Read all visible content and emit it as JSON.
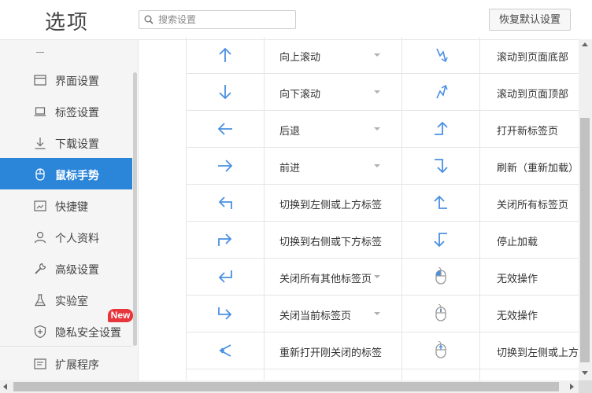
{
  "header": {
    "title": "选项",
    "search_placeholder": "搜索设置",
    "reset_button": "恢复默认设置"
  },
  "sidebar": {
    "items": [
      {
        "label": "界面设置",
        "icon": "window-icon"
      },
      {
        "label": "标签设置",
        "icon": "laptop-icon"
      },
      {
        "label": "下载设置",
        "icon": "download-icon"
      },
      {
        "label": "鼠标手势",
        "icon": "mouse-icon",
        "active": true
      },
      {
        "label": "快捷键",
        "icon": "keyboard-icon"
      },
      {
        "label": "个人资料",
        "icon": "person-icon"
      },
      {
        "label": "高级设置",
        "icon": "wrench-icon"
      },
      {
        "label": "实验室",
        "icon": "flask-icon"
      },
      {
        "label": "隐私安全设置",
        "icon": "shield-icon",
        "badge": "New"
      },
      {
        "label": "扩展程序",
        "icon": "extension-icon"
      }
    ],
    "accent_color": "#2b86d9",
    "badge_color": "#e8343b"
  },
  "gestures": {
    "left_column": [
      {
        "icon": "arrow-up-icon",
        "action": "向上滚动",
        "has_dropdown": true
      },
      {
        "icon": "arrow-down-icon",
        "action": "向下滚动",
        "has_dropdown": true
      },
      {
        "icon": "arrow-left-icon",
        "action": "后退",
        "has_dropdown": true
      },
      {
        "icon": "arrow-right-icon",
        "action": "前进",
        "has_dropdown": true
      },
      {
        "icon": "arrow-up-left-icon",
        "action": "切换到左侧或上方标签",
        "has_dropdown": true
      },
      {
        "icon": "arrow-up-right-icon",
        "action": "切换到右侧或下方标签",
        "has_dropdown": true
      },
      {
        "icon": "arrow-down-left-icon",
        "action": "关闭所有其他标签页",
        "has_dropdown": true
      },
      {
        "icon": "arrow-down-right-icon",
        "action": "关闭当前标签页",
        "has_dropdown": true
      },
      {
        "icon": "arrow-zigzag-left-icon",
        "action": "重新打开刚关闭的标签",
        "has_dropdown": true
      }
    ],
    "right_column": [
      {
        "icon": "zigzag-down-icon",
        "action": "滚动到页面底部"
      },
      {
        "icon": "zigzag-up-icon",
        "action": "滚动到页面顶部"
      },
      {
        "icon": "arrow-right-up-icon",
        "action": "打开新标签页"
      },
      {
        "icon": "arrow-right-down-icon",
        "action": "刷新（重新加载）"
      },
      {
        "icon": "arrow-left-up-icon",
        "action": "关闭所有标签页"
      },
      {
        "icon": "arrow-left-down-icon",
        "action": "停止加载"
      },
      {
        "icon": "mouse-left-click-icon",
        "action": "无效操作"
      },
      {
        "icon": "mouse-middle-click-icon",
        "action": "无效操作"
      },
      {
        "icon": "mouse-scroll-up-icon",
        "action": "切换到左侧或上方"
      }
    ],
    "icon_color": "#4a90e2"
  }
}
